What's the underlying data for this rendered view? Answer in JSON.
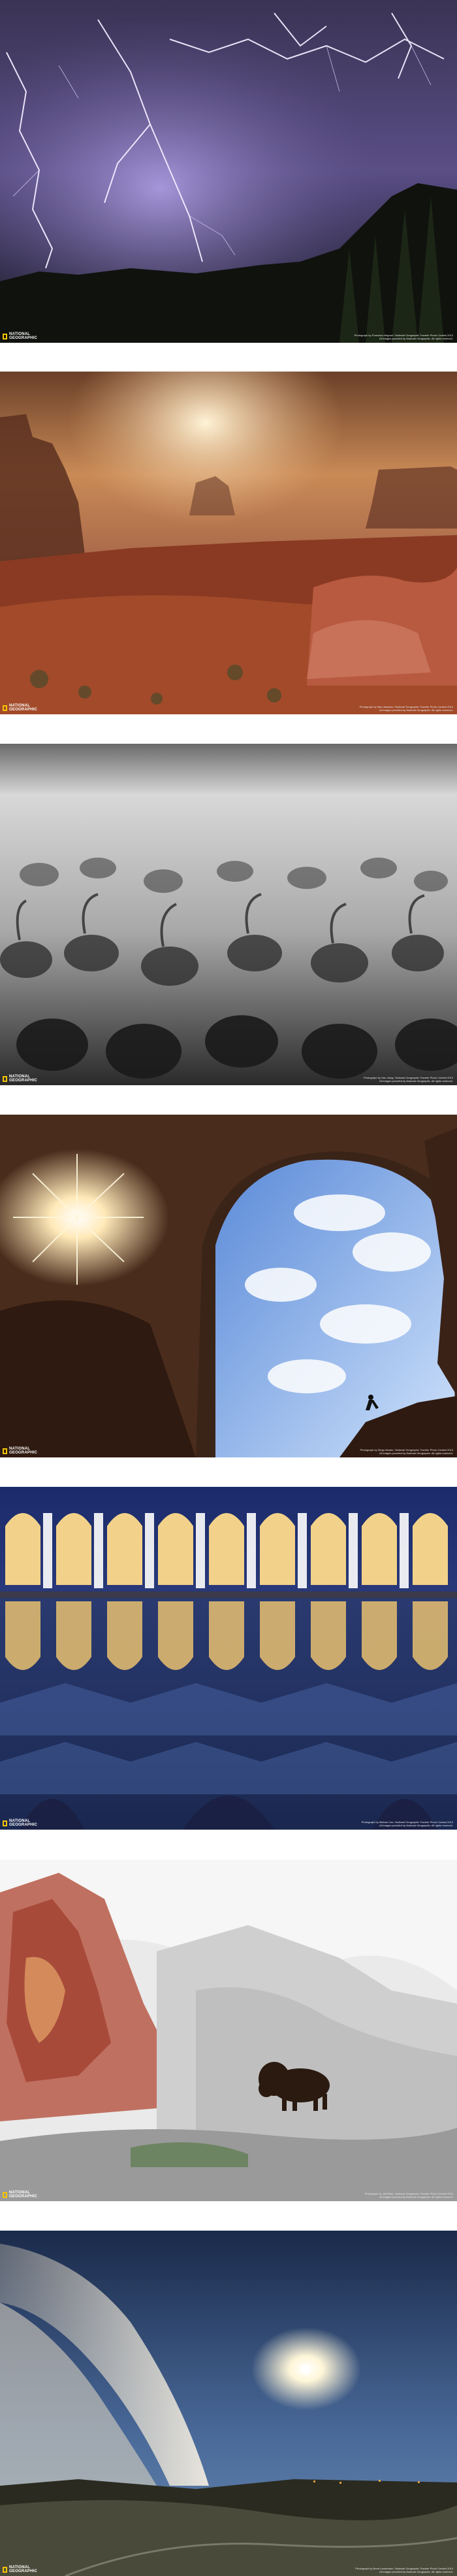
{
  "brand": {
    "logo_text": "NATIONAL GEOGRAPHIC",
    "frame_color": "#f5c400"
  },
  "photos": [
    {
      "subject": "lightning storm over volcano",
      "credit_line": "Photograph by Francisco Negroni / National Geographic Traveler Photo Contest 2013",
      "rights_line": "All images provided by National Geographic. All rights reserved."
    },
    {
      "subject": "desert buttes in hazy sunlight",
      "credit_line": "Photograph by Marc Adamus / National Geographic Traveler Photo Contest 2013",
      "rights_line": "All images provided by National Geographic. All rights reserved."
    },
    {
      "subject": "cranes in fog",
      "credit_line": "Photograph by Hao Jiang / National Geographic Traveler Photo Contest 2013",
      "rights_line": "All images provided by National Geographic. All rights reserved."
    },
    {
      "subject": "rock arch with sunburst and climber",
      "credit_line": "Photograph by Diego Marais / National Geographic Traveler Photo Contest 2013",
      "rights_line": "All images provided by National Geographic. All rights reserved."
    },
    {
      "subject": "mosque arcade reflected in pool",
      "credit_line": "Photograph by Michael Lim / National Geographic Traveler Photo Contest 2013",
      "rights_line": "All images provided by National Geographic. All rights reserved."
    },
    {
      "subject": "bison at hot spring terraces",
      "credit_line": "Photograph by Jeff Mark / National Geographic Traveler Photo Contest 2013",
      "rights_line": "All images provided by National Geographic. All rights reserved."
    },
    {
      "subject": "geyser under moonlit sky",
      "credit_line": "Photograph by Brent Lamoreaux / National Geographic Traveler Photo Contest 2013",
      "rights_line": "All images provided by National Geographic. All rights reserved."
    }
  ]
}
